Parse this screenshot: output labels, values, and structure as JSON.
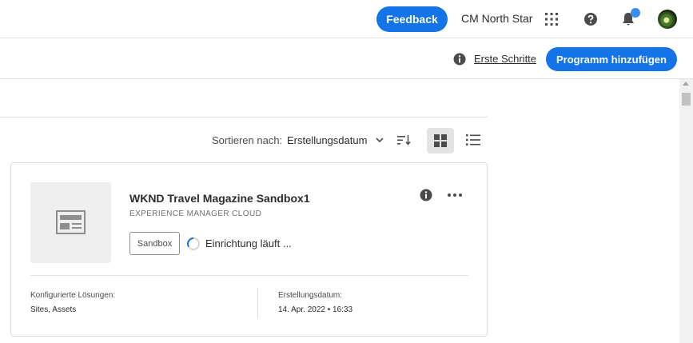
{
  "header": {
    "feedback_label": "Feedback",
    "org_name": "CM North Star",
    "icons": [
      "apps-grid-icon",
      "help-icon",
      "bell-icon",
      "avatar"
    ],
    "accent": "#1473e6"
  },
  "actionbar": {
    "getting_started_label": "Erste Schritte",
    "add_program_label": "Programm hinzufügen"
  },
  "toolbar": {
    "sort_label": "Sortieren nach:",
    "sort_value": "Erstellungsdatum",
    "view_mode": "grid"
  },
  "card": {
    "title": "WKND Travel Magazine Sandbox1",
    "subtitle": "EXPERIENCE MANAGER CLOUD",
    "badge": "Sandbox",
    "status": "Einrichtung läuft ...",
    "solutions_label": "Konfigurierte Lösungen:",
    "solutions_value": "Sites, Assets",
    "created_label": "Erstellungsdatum:",
    "created_value": "14. Apr. 2022 • 16:33"
  }
}
